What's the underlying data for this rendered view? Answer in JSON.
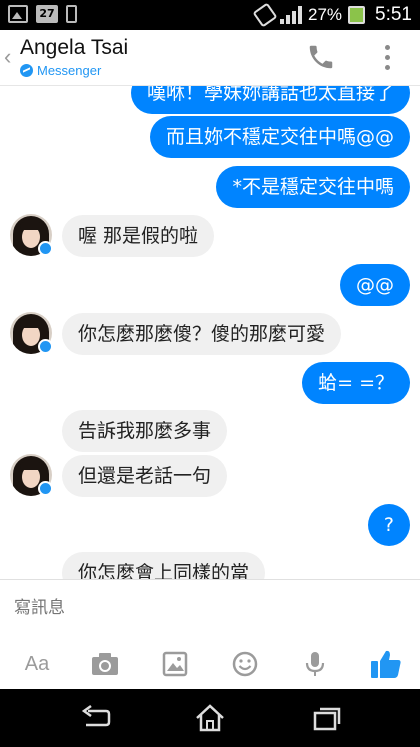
{
  "status_bar": {
    "calendar_day": "27",
    "battery_percent": "27%",
    "time": "5:51"
  },
  "header": {
    "contact_name": "Angela Tsai",
    "app_label": "Messenger"
  },
  "messages": [
    {
      "from": "me",
      "text": "嘆咻！學妹妳講話也太直接了"
    },
    {
      "from": "me",
      "text": "而且妳不穩定交往中嗎@@"
    },
    {
      "from": "me",
      "text": "*不是穩定交往中嗎"
    },
    {
      "from": "them",
      "text": "喔 那是假的啦"
    },
    {
      "from": "me",
      "text": "@@"
    },
    {
      "from": "them",
      "text": "你怎麼那麼傻？傻的那麼可愛"
    },
    {
      "from": "me",
      "text": "蛤= =？"
    },
    {
      "from": "them",
      "text": "告訴我那麼多事"
    },
    {
      "from": "them",
      "text": "但還是老話一句"
    },
    {
      "from": "me",
      "text": "?"
    },
    {
      "from": "them",
      "text": "你怎麼會上同樣的當"
    }
  ],
  "composer": {
    "placeholder": "寫訊息",
    "aa_label": "Aa"
  },
  "icons": {
    "call": "phone-icon",
    "more": "more-vertical-icon",
    "camera": "camera-icon",
    "gallery": "image-icon",
    "emoji": "smiley-icon",
    "voice": "microphone-icon",
    "like": "thumbs-up-icon"
  },
  "colors": {
    "accent": "#0084ff",
    "incoming_bubble": "#f0f0f0",
    "like_icon": "#2196f3"
  }
}
